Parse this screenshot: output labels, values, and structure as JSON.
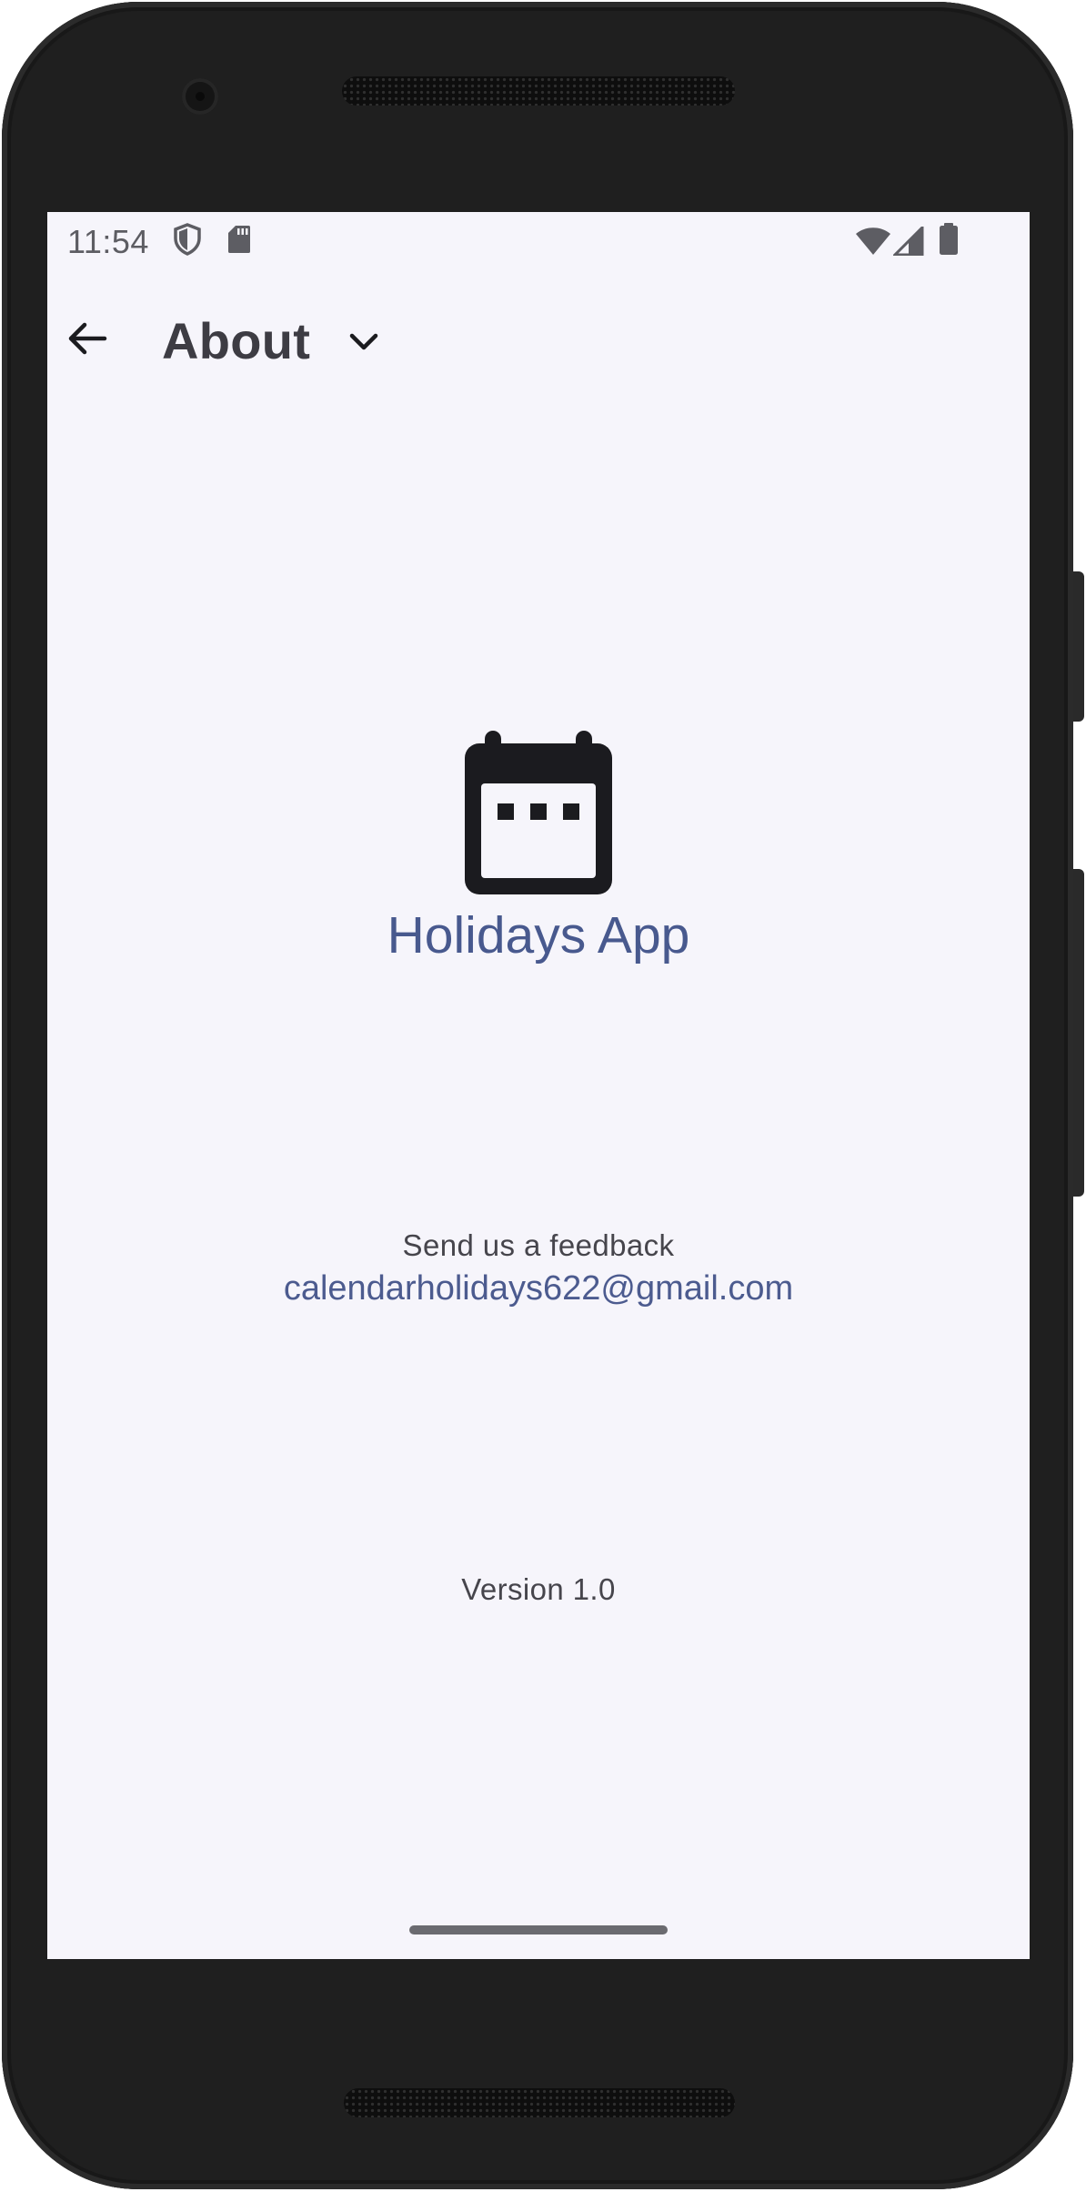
{
  "status_bar": {
    "time": "11:54",
    "icons": [
      "shield-icon",
      "sd-card-icon",
      "wifi-icon",
      "cell-signal-icon",
      "battery-icon"
    ]
  },
  "app_bar": {
    "back_icon": "arrow-back-icon",
    "title": "About",
    "dropdown_icon": "chevron-down-icon"
  },
  "main": {
    "logo_icon": "calendar-icon",
    "app_name": "Holidays App",
    "feedback_label": "Send us a feedback",
    "feedback_email": "calendarholidays622@gmail.com",
    "version": "Version 1.0"
  },
  "colors": {
    "background": "#f6f5fb",
    "accent": "#48598e",
    "text_primary": "#3d3c43",
    "text_secondary": "#46454c",
    "icon": "#1b1b1f"
  }
}
